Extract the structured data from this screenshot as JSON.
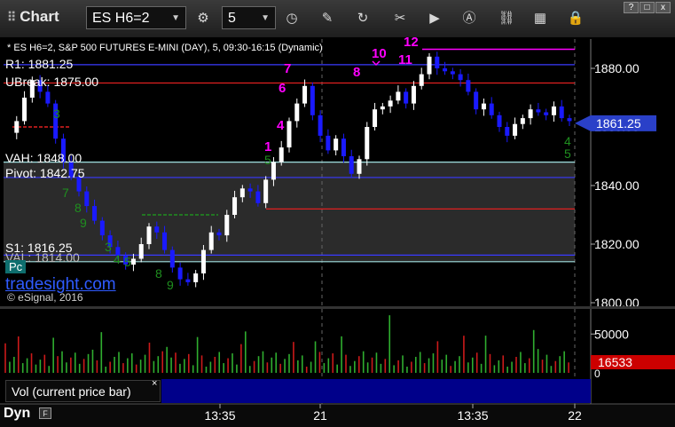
{
  "toolbar": {
    "title": "Chart",
    "symbol": "ES H6=2",
    "interval": "5",
    "window_buttons": [
      "?",
      "□",
      "x"
    ]
  },
  "chart_header": "* ES H6=2, S&P 500 FUTURES E-MINI (DAY), 5, 09:30-16:15 (Dynamic)",
  "levels": [
    {
      "label": "R1: 1881.25",
      "price": 1881.25,
      "color": "#3a3aff"
    },
    {
      "label": "UBreak: 1875.00",
      "price": 1875.0,
      "color": "#e02020"
    },
    {
      "label": "VAH: 1848.00",
      "price": 1848.0,
      "color": "#9fe0e0"
    },
    {
      "label": "Pivot: 1842.75",
      "price": 1842.75,
      "color": "#3a3aff"
    },
    {
      "label": "S1: 1816.25",
      "price": 1816.25,
      "color": "#3a3aff"
    },
    {
      "label": "VAL: 1814.00",
      "price": 1814.0,
      "color": "#9fe0e0"
    }
  ],
  "pc_badge": "Pc",
  "branding": {
    "logo": "tradesight.com",
    "copyright": "© eSignal, 2016"
  },
  "volume_panel": {
    "label": "Vol (current price bar)",
    "last_volume_label": "16533",
    "zero_label": "0"
  },
  "footer": {
    "mode": "Dyn"
  },
  "colors": {
    "up": "#ffffff",
    "down": "#1a1aff",
    "annot": "#ff00ff",
    "seq": "#1f8f1f",
    "last_price_bg": "#2a40c8",
    "vol_last_bg": "#cc0000"
  },
  "chart_data": {
    "type": "candlestick",
    "title": "* ES H6=2, S&P 500 FUTURES E-MINI (DAY), 5, 09:30-16:15 (Dynamic)",
    "y_axis": {
      "min": 1800,
      "max": 1890,
      "ticks": [
        1800,
        1820,
        1840,
        1860,
        1880
      ]
    },
    "x_ticks": [
      "13:35",
      "21",
      "13:35",
      "22"
    ],
    "last_price": 1861.25,
    "close_path": [
      1858,
      1862,
      1870,
      1876,
      1872,
      1868,
      1856,
      1848,
      1843,
      1838,
      1833,
      1828,
      1823,
      1819,
      1816,
      1813,
      1815,
      1820,
      1826,
      1824,
      1818,
      1812,
      1808,
      1807,
      1810,
      1818,
      1824,
      1823,
      1830,
      1836,
      1839,
      1838,
      1834,
      1842,
      1848,
      1853,
      1862,
      1868,
      1874,
      1864,
      1857,
      1852,
      1856,
      1850,
      1844,
      1849,
      1860,
      1866,
      1867,
      1869,
      1872,
      1868,
      1874,
      1878,
      1884,
      1880,
      1879,
      1878,
      1876,
      1872,
      1866,
      1868,
      1864,
      1860,
      1857,
      1861,
      1863,
      1866,
      1865,
      1864,
      1867,
      1863,
      1862
    ],
    "bars_per_day": 81,
    "markers": [
      {
        "text": "7",
        "x": "day1 13:40",
        "price": 1884
      },
      {
        "text": "8",
        "x": "day2 10:40",
        "price": 1880
      },
      {
        "text": "10",
        "x": "day2 11:10",
        "price": 1885
      },
      {
        "text": "11",
        "x": "day2 11:45",
        "price": 1883
      },
      {
        "text": "12",
        "x": "day2 12:00",
        "price": 1887
      },
      {
        "text": "1",
        "x": "day1 13:00",
        "price": 1861
      }
    ],
    "volume": {
      "y_ticks": [
        0,
        50000
      ],
      "last": 16533
    }
  }
}
